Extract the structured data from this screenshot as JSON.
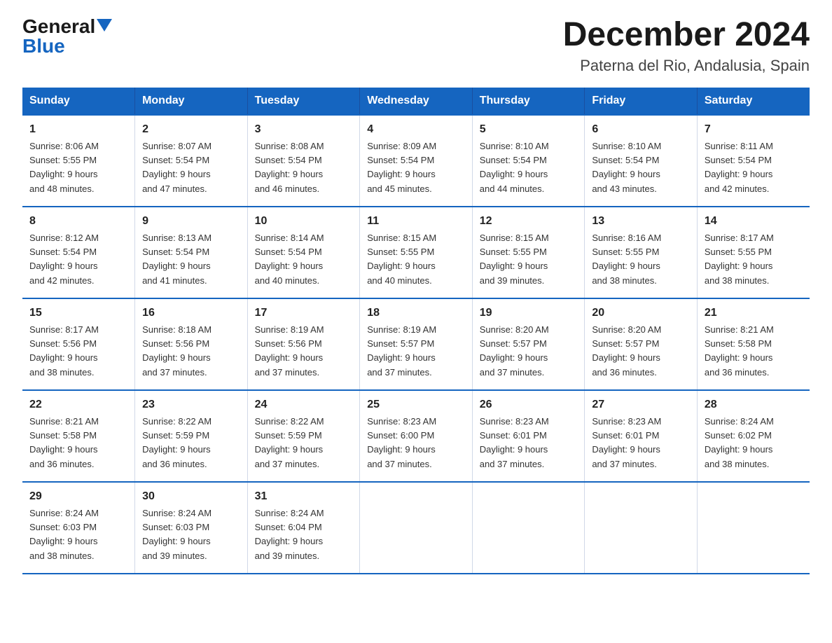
{
  "logo": {
    "general": "General",
    "blue": "Blue",
    "triangle": "▶"
  },
  "title": "December 2024",
  "location": "Paterna del Rio, Andalusia, Spain",
  "days_of_week": [
    "Sunday",
    "Monday",
    "Tuesday",
    "Wednesday",
    "Thursday",
    "Friday",
    "Saturday"
  ],
  "weeks": [
    [
      {
        "day": "1",
        "sunrise": "8:06 AM",
        "sunset": "5:55 PM",
        "daylight": "9 hours and 48 minutes."
      },
      {
        "day": "2",
        "sunrise": "8:07 AM",
        "sunset": "5:54 PM",
        "daylight": "9 hours and 47 minutes."
      },
      {
        "day": "3",
        "sunrise": "8:08 AM",
        "sunset": "5:54 PM",
        "daylight": "9 hours and 46 minutes."
      },
      {
        "day": "4",
        "sunrise": "8:09 AM",
        "sunset": "5:54 PM",
        "daylight": "9 hours and 45 minutes."
      },
      {
        "day": "5",
        "sunrise": "8:10 AM",
        "sunset": "5:54 PM",
        "daylight": "9 hours and 44 minutes."
      },
      {
        "day": "6",
        "sunrise": "8:10 AM",
        "sunset": "5:54 PM",
        "daylight": "9 hours and 43 minutes."
      },
      {
        "day": "7",
        "sunrise": "8:11 AM",
        "sunset": "5:54 PM",
        "daylight": "9 hours and 42 minutes."
      }
    ],
    [
      {
        "day": "8",
        "sunrise": "8:12 AM",
        "sunset": "5:54 PM",
        "daylight": "9 hours and 42 minutes."
      },
      {
        "day": "9",
        "sunrise": "8:13 AM",
        "sunset": "5:54 PM",
        "daylight": "9 hours and 41 minutes."
      },
      {
        "day": "10",
        "sunrise": "8:14 AM",
        "sunset": "5:54 PM",
        "daylight": "9 hours and 40 minutes."
      },
      {
        "day": "11",
        "sunrise": "8:15 AM",
        "sunset": "5:55 PM",
        "daylight": "9 hours and 40 minutes."
      },
      {
        "day": "12",
        "sunrise": "8:15 AM",
        "sunset": "5:55 PM",
        "daylight": "9 hours and 39 minutes."
      },
      {
        "day": "13",
        "sunrise": "8:16 AM",
        "sunset": "5:55 PM",
        "daylight": "9 hours and 38 minutes."
      },
      {
        "day": "14",
        "sunrise": "8:17 AM",
        "sunset": "5:55 PM",
        "daylight": "9 hours and 38 minutes."
      }
    ],
    [
      {
        "day": "15",
        "sunrise": "8:17 AM",
        "sunset": "5:56 PM",
        "daylight": "9 hours and 38 minutes."
      },
      {
        "day": "16",
        "sunrise": "8:18 AM",
        "sunset": "5:56 PM",
        "daylight": "9 hours and 37 minutes."
      },
      {
        "day": "17",
        "sunrise": "8:19 AM",
        "sunset": "5:56 PM",
        "daylight": "9 hours and 37 minutes."
      },
      {
        "day": "18",
        "sunrise": "8:19 AM",
        "sunset": "5:57 PM",
        "daylight": "9 hours and 37 minutes."
      },
      {
        "day": "19",
        "sunrise": "8:20 AM",
        "sunset": "5:57 PM",
        "daylight": "9 hours and 37 minutes."
      },
      {
        "day": "20",
        "sunrise": "8:20 AM",
        "sunset": "5:57 PM",
        "daylight": "9 hours and 36 minutes."
      },
      {
        "day": "21",
        "sunrise": "8:21 AM",
        "sunset": "5:58 PM",
        "daylight": "9 hours and 36 minutes."
      }
    ],
    [
      {
        "day": "22",
        "sunrise": "8:21 AM",
        "sunset": "5:58 PM",
        "daylight": "9 hours and 36 minutes."
      },
      {
        "day": "23",
        "sunrise": "8:22 AM",
        "sunset": "5:59 PM",
        "daylight": "9 hours and 36 minutes."
      },
      {
        "day": "24",
        "sunrise": "8:22 AM",
        "sunset": "5:59 PM",
        "daylight": "9 hours and 37 minutes."
      },
      {
        "day": "25",
        "sunrise": "8:23 AM",
        "sunset": "6:00 PM",
        "daylight": "9 hours and 37 minutes."
      },
      {
        "day": "26",
        "sunrise": "8:23 AM",
        "sunset": "6:01 PM",
        "daylight": "9 hours and 37 minutes."
      },
      {
        "day": "27",
        "sunrise": "8:23 AM",
        "sunset": "6:01 PM",
        "daylight": "9 hours and 37 minutes."
      },
      {
        "day": "28",
        "sunrise": "8:24 AM",
        "sunset": "6:02 PM",
        "daylight": "9 hours and 38 minutes."
      }
    ],
    [
      {
        "day": "29",
        "sunrise": "8:24 AM",
        "sunset": "6:03 PM",
        "daylight": "9 hours and 38 minutes."
      },
      {
        "day": "30",
        "sunrise": "8:24 AM",
        "sunset": "6:03 PM",
        "daylight": "9 hours and 39 minutes."
      },
      {
        "day": "31",
        "sunrise": "8:24 AM",
        "sunset": "6:04 PM",
        "daylight": "9 hours and 39 minutes."
      },
      null,
      null,
      null,
      null
    ]
  ],
  "labels": {
    "sunrise": "Sunrise:",
    "sunset": "Sunset:",
    "daylight": "Daylight:"
  }
}
